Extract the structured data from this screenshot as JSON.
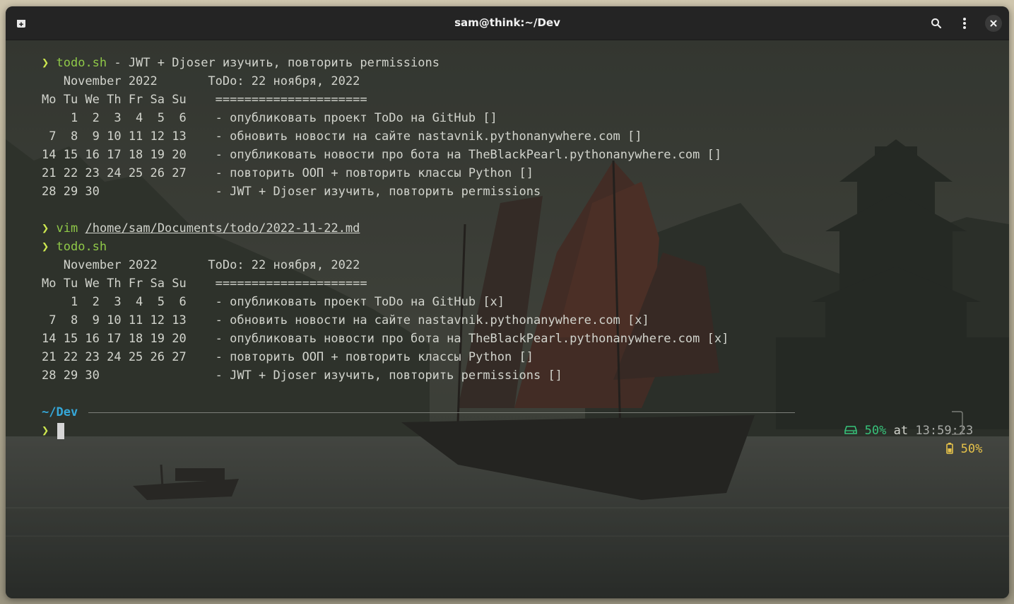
{
  "window": {
    "title": "sam@think:~/Dev",
    "icons": [
      "new-tab-icon",
      "search-icon",
      "menu-kebab-icon",
      "close-icon"
    ]
  },
  "prompt_symbol": "❯",
  "block1": {
    "cmd": "todo.sh",
    "args": " - JWT + Djoser изучить, повторить permissions",
    "lines": [
      "   November 2022       ToDo: 22 ноября, 2022",
      "Mo Tu We Th Fr Sa Su    =====================",
      "    1  2  3  4  5  6    - опубликовать проект ToDo на GitHub []",
      " 7  8  9 10 11 12 13    - обновить новости на сайте nastavnik.pythonanywhere.com []",
      "14 15 16 17 18 19 20    - опубликовать новости про бота на TheBlackPearl.pythonanywhere.com []",
      "21 22 23 24 25 26 27    - повторить ООП + повторить классы Python []",
      "28 29 30                - JWT + Djoser изучить, повторить permissions"
    ]
  },
  "block2": {
    "cmd": "vim",
    "path": "/home/sam/Documents/todo/2022-11-22.md"
  },
  "block3": {
    "cmd": "todo.sh",
    "lines": [
      "   November 2022       ToDo: 22 ноября, 2022",
      "Mo Tu We Th Fr Sa Su    =====================",
      "    1  2  3  4  5  6    - опубликовать проект ToDo на GitHub [x]",
      " 7  8  9 10 11 12 13    - обновить новости на сайте nastavnik.pythonanywhere.com [x]",
      "14 15 16 17 18 19 20    - опубликовать новости про бота на TheBlackPearl.pythonanywhere.com [x]",
      "21 22 23 24 25 26 27    - повторить ООП + повторить классы Python []",
      "28 29 30                - JWT + Djoser изучить, повторить permissions []"
    ]
  },
  "status": {
    "cwd_home": "~/",
    "cwd_dir": "Dev",
    "disk_pct": "50%",
    "at": "at",
    "time": "13:59:23",
    "battery_pct": "50%",
    "disk_icon": "hard-drive-icon",
    "battery_icon": "battery-icon"
  },
  "colors": {
    "prompt": "#cde84f",
    "command": "#8fc848",
    "directory": "#35a7d8",
    "disk_pct": "#37c27a",
    "battery": "#e6c24a"
  }
}
